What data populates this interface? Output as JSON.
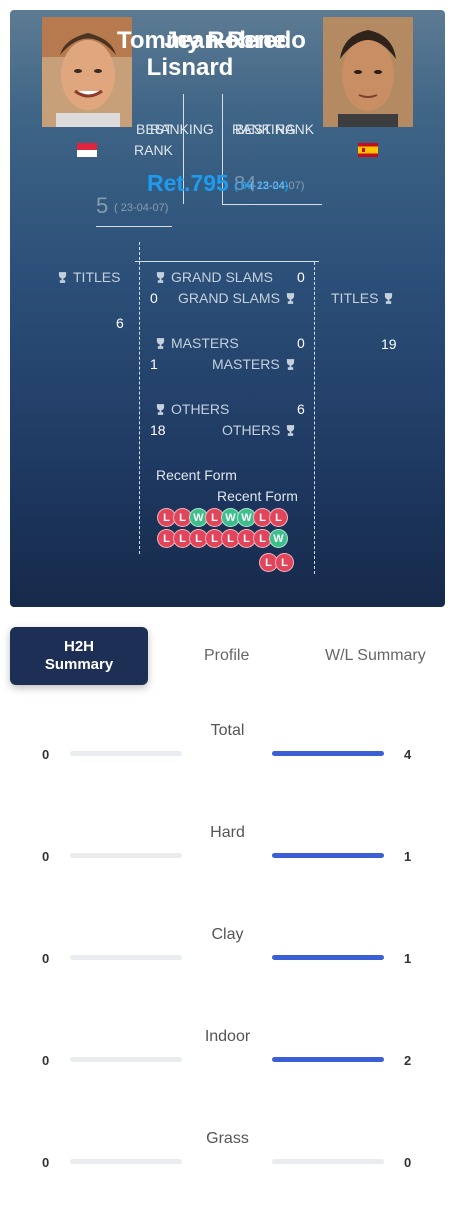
{
  "player_left": {
    "name": "Tommy Robredo",
    "best_rank_label": "BEST RANK",
    "best_rank_value": "5",
    "best_rank_date": "( 23-04-07)",
    "ranking_label": "RANKING",
    "ranking_value": "Ret.795",
    "ranking_date": "( 06-12-24)",
    "flag": "Spain",
    "titles": {
      "total": "6",
      "grand_slams": "0",
      "masters": "1",
      "others": "18"
    }
  },
  "player_right": {
    "name": "Jean-Rene Lisnard",
    "best_rank_label": "BEST RANK",
    "best_rank_value": "84",
    "best_rank_date": "( 23-04-07)",
    "ranking_label": "RANKING",
    "ranking_value": "Ret.795",
    "ranking_date": "( 06-12-24)",
    "flag": "Monaco",
    "titles": {
      "total": "19",
      "grand_slams": "0",
      "masters": "0",
      "others": "6"
    }
  },
  "labels": {
    "titles": "TITLES",
    "grand_slams": "GRAND SLAMS",
    "masters": "MASTERS",
    "others": "OTHERS",
    "recent_form": "Recent Form",
    "rank_word": "RANK"
  },
  "left_display": {
    "name_line1": "Tommy Robredo",
    "best_rank": "BEST",
    "rank": "RANK",
    "best_rank_value": "5",
    "best_rank_date": "( 23-04-07)",
    "ranking_value": "Ret.795",
    "ranking_date": "( 06-12-24)",
    "titles_total": "6"
  },
  "right_display": {
    "name_line1": "Jean-Rene",
    "name_line2": "Lisnard",
    "ranking_label": "RANKING",
    "best_rank_label": "BEST RANK",
    "best_rank_value": "84",
    "best_rank_date": "( 23-04-07)",
    "ranking_date": "( 06-12-24)",
    "titles_total": "19"
  },
  "form_left": [
    "L",
    "L",
    "W",
    "L",
    "W",
    "W",
    "L",
    "L"
  ],
  "form_right_row1": [
    "L",
    "L",
    "L",
    "L",
    "L",
    "L",
    "L",
    "W"
  ],
  "form_right_row2": [
    "L",
    "L"
  ],
  "tabs": {
    "h2h_line1": "H2H",
    "h2h_line2": "Summary",
    "profile": "Profile",
    "wl": "W/L Summary"
  },
  "summary": [
    {
      "surface": "Total",
      "left": "0",
      "right": "4",
      "left_frac": 0,
      "right_frac": 1
    },
    {
      "surface": "Hard",
      "left": "0",
      "right": "1",
      "left_frac": 0,
      "right_frac": 1
    },
    {
      "surface": "Clay",
      "left": "0",
      "right": "1",
      "left_frac": 0,
      "right_frac": 1
    },
    {
      "surface": "Indoor",
      "left": "0",
      "right": "2",
      "left_frac": 0,
      "right_frac": 1
    },
    {
      "surface": "Grass",
      "left": "0",
      "right": "0",
      "left_frac": 0,
      "right_frac": 0
    }
  ],
  "colors": {
    "win": "#3cbf8a",
    "loss": "#e0455b",
    "bar": "#3c5fd6",
    "rank_blue": "#1d9bf0",
    "tab_active": "#1e2f55"
  }
}
